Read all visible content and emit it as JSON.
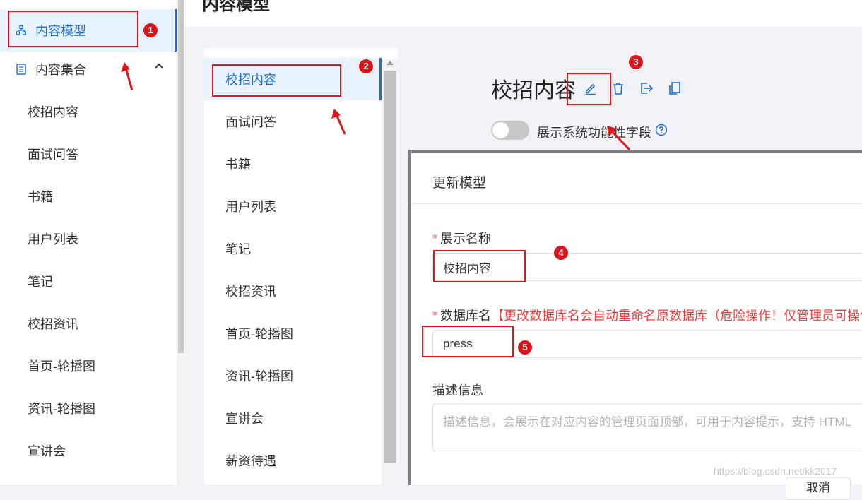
{
  "page": {
    "title": "内容模型"
  },
  "sidebar": {
    "top_items": [
      {
        "label": "内容模型",
        "icon": "model-icon"
      },
      {
        "label": "内容集合",
        "icon": "collection-icon"
      }
    ],
    "sub_items": [
      "校招内容",
      "面试问答",
      "书籍",
      "用户列表",
      "笔记",
      "校招资讯",
      "首页-轮播图",
      "资讯-轮播图",
      "宣讲会"
    ]
  },
  "model_list": {
    "items": [
      "校招内容",
      "面试问答",
      "书籍",
      "用户列表",
      "笔记",
      "校招资讯",
      "首页-轮播图",
      "资讯-轮播图",
      "宣讲会",
      "薪资待遇"
    ]
  },
  "model_header": {
    "title": "校招内容",
    "toggle_label": "展示系统功能性字段",
    "toggle_on": false
  },
  "dialog": {
    "title": "更新模型",
    "required_mark": "*",
    "display_name_label": "展示名称",
    "display_name_value": "校招内容",
    "db_name_label": "数据库名",
    "db_name_warning": "【更改数据库名会自动重命名原数据库（危险操作！仅管理员可操作",
    "db_name_value": "press",
    "description_label": "描述信息",
    "description_placeholder": "描述信息，会展示在对应内容的管理页面顶部，可用于内容提示，支持 HTML",
    "cancel_label": "取消"
  },
  "annotations": {
    "badges": [
      "1",
      "2",
      "3",
      "4",
      "5"
    ]
  },
  "watermark": "https://blog.csdn.net/kk2017",
  "colors": {
    "accent": "#1f6fd1",
    "annotation": "#e0161b",
    "warning": "#f23a3a",
    "active_bg": "#e8f3ff"
  }
}
